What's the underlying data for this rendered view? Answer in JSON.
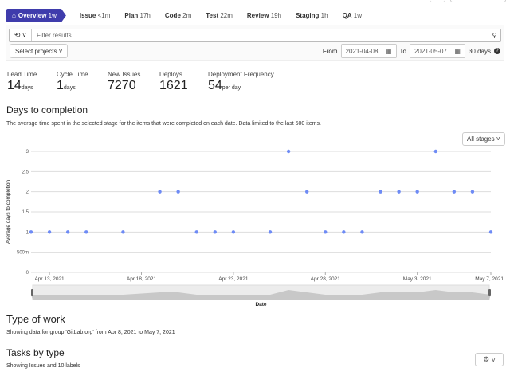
{
  "stages": [
    {
      "name": "Overview",
      "time": "1w",
      "active": true
    },
    {
      "name": "Issue",
      "time": "<1m"
    },
    {
      "name": "Plan",
      "time": "17h"
    },
    {
      "name": "Code",
      "time": "2m"
    },
    {
      "name": "Test",
      "time": "22m"
    },
    {
      "name": "Review",
      "time": "19h"
    },
    {
      "name": "Staging",
      "time": "1h"
    },
    {
      "name": "QA",
      "time": "1w"
    }
  ],
  "filter": {
    "placeholder": "Filter results",
    "projects_label": "Select projects",
    "from_label": "From",
    "from": "2021-04-08",
    "to_label": "To",
    "to": "2021-05-07",
    "days": "30 days"
  },
  "metrics": [
    {
      "label": "Lead Time",
      "value": "14",
      "unit": "days"
    },
    {
      "label": "Cycle Time",
      "value": "1",
      "unit": "days"
    },
    {
      "label": "New Issues",
      "value": "7270",
      "unit": ""
    },
    {
      "label": "Deploys",
      "value": "1621",
      "unit": ""
    },
    {
      "label": "Deployment Frequency",
      "value": "54",
      "unit": "per day"
    }
  ],
  "completion": {
    "title": "Days to completion",
    "description": "The average time spent in the selected stage for the items that were completed on each date. Data limited to the last 500 items.",
    "stage_select": "All stages"
  },
  "chart_data": {
    "type": "scatter",
    "xlabel": "Date",
    "ylabel": "Average days to completion",
    "ylim": [
      0,
      3
    ],
    "yticks": [
      "0",
      "500m",
      "1",
      "1.5",
      "2",
      "2.5",
      "3"
    ],
    "xticks": [
      "Apr 13, 2021",
      "Apr 18, 2021",
      "Apr 23, 2021",
      "Apr 28, 2021",
      "May 3, 2021",
      "May 7, 2021"
    ],
    "xlim": [
      "2021-04-12",
      "2021-05-07"
    ],
    "color": "#6e8bf5",
    "grid": true,
    "points": [
      [
        "2021-04-12",
        1
      ],
      [
        "2021-04-13",
        1
      ],
      [
        "2021-04-14",
        1
      ],
      [
        "2021-04-15",
        1
      ],
      [
        "2021-04-17",
        1
      ],
      [
        "2021-04-19",
        2
      ],
      [
        "2021-04-20",
        2
      ],
      [
        "2021-04-21",
        1
      ],
      [
        "2021-04-22",
        1
      ],
      [
        "2021-04-23",
        1
      ],
      [
        "2021-04-25",
        1
      ],
      [
        "2021-04-26",
        3
      ],
      [
        "2021-04-27",
        2
      ],
      [
        "2021-04-28",
        1
      ],
      [
        "2021-04-29",
        1
      ],
      [
        "2021-04-30",
        1
      ],
      [
        "2021-05-01",
        2
      ],
      [
        "2021-05-02",
        2
      ],
      [
        "2021-05-03",
        2
      ],
      [
        "2021-05-04",
        3
      ],
      [
        "2021-05-05",
        2
      ],
      [
        "2021-05-06",
        2
      ],
      [
        "2021-05-07",
        1
      ]
    ]
  },
  "type_of_work": {
    "title": "Type of work",
    "description": "Showing data for group 'GitLab.org' from Apr 8, 2021 to May 7, 2021",
    "tasks_title": "Tasks by type",
    "tasks_description": "Showing Issues and 10 labels"
  }
}
